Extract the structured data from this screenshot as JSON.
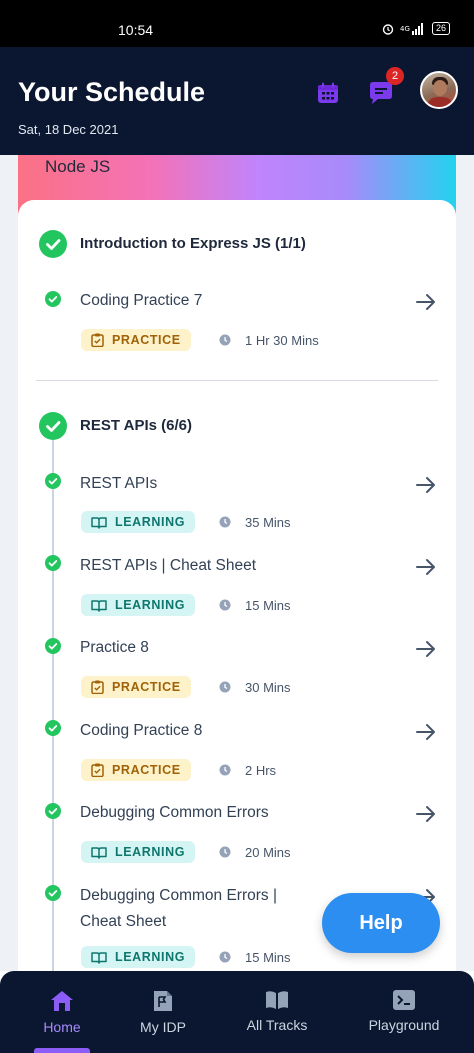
{
  "status_bar": {
    "time": "10:54",
    "battery": "26"
  },
  "header": {
    "title": "Your Schedule",
    "date": "Sat, 18 Dec 2021",
    "chat_badge": "2"
  },
  "banner": {
    "course": "Node JS"
  },
  "groups": [
    {
      "title": "Introduction to Express JS (1/1)",
      "items": [
        {
          "title": "Coding Practice 7",
          "type": "PRACTICE",
          "duration": "1 Hr 30 Mins"
        }
      ]
    },
    {
      "title": "REST APIs (6/6)",
      "items": [
        {
          "title": "REST APIs",
          "type": "LEARNING",
          "duration": "35 Mins"
        },
        {
          "title": "REST APIs | Cheat Sheet",
          "type": "LEARNING",
          "duration": "15 Mins"
        },
        {
          "title": "Practice 8",
          "type": "PRACTICE",
          "duration": "30 Mins"
        },
        {
          "title": "Coding Practice 8",
          "type": "PRACTICE",
          "duration": "2 Hrs"
        },
        {
          "title": "Debugging Common Errors",
          "type": "LEARNING",
          "duration": "20 Mins"
        },
        {
          "title_line1": "Debugging Common Errors |",
          "title_line2": "Cheat Sheet",
          "type": "LEARNING",
          "duration": "15 Mins"
        }
      ]
    }
  ],
  "help": {
    "label": "Help"
  },
  "bottom_nav": [
    {
      "label": "Home",
      "active": true
    },
    {
      "label": "My IDP"
    },
    {
      "label": "All Tracks"
    },
    {
      "label": "Playground"
    }
  ],
  "colors": {
    "header_bg": "#0b1730",
    "accent": "#8b5cf6",
    "success": "#22c55e",
    "help": "#2b8ef0"
  }
}
